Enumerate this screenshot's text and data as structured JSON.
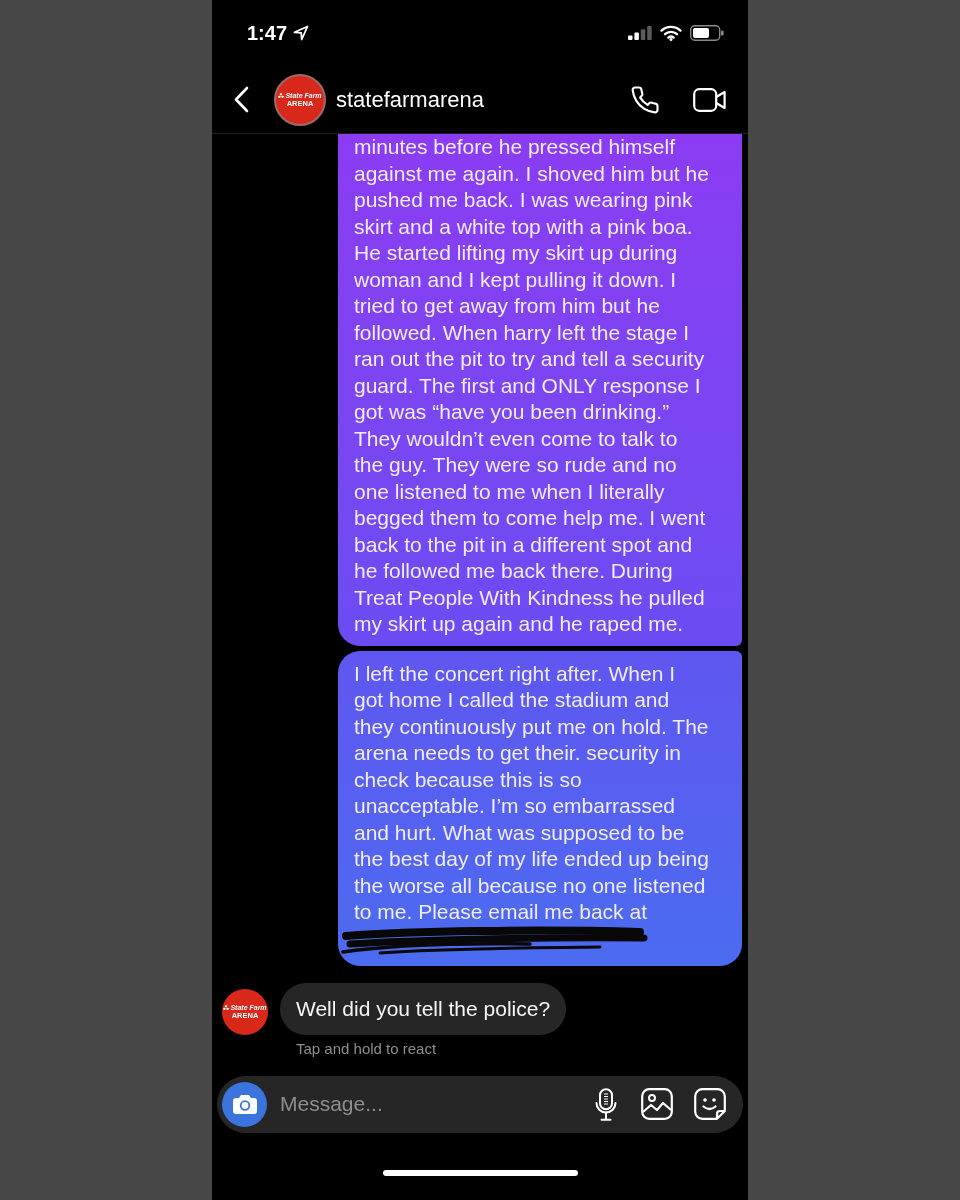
{
  "status_bar": {
    "time": "1:47"
  },
  "header": {
    "name": "statefarmarena",
    "avatar_logo": [
      "State Farm",
      "ARENA"
    ]
  },
  "messages": [
    {
      "kind": "outgoing",
      "text": "minutes before he pressed himself\nagainst me again. I shoved him but he\npushed me back. I was wearing pink\nskirt and a white top with a pink boa.\nHe started lifting my skirt up during\nwoman and I kept pulling it down. I\ntried to get away from him but he\nfollowed. When harry left the stage I\nran out the pit to try and tell a security\nguard. The first and ONLY response I\ngot was “have you been drinking.”\nThey wouldn’t even come to talk to\nthe guy. They were so rude and no\none listened to me when I literally\nbegged them to come help me. I went\nback to the pit in a different spot and\nhe followed me back there. During\nTreat People With Kindness he pulled\nmy skirt up again and he raped me.",
      "redacted": false
    },
    {
      "kind": "outgoing",
      "text": "I left the concert right after. When I\ngot home I called the stadium and\nthey continuously put me on hold. The\narena needs to get their. security in\ncheck because this is so\nunacceptable. I’m so embarrassed\nand hurt. What was supposed to be\nthe best day of my life ended up being\nthe worse all because no one listened\nto me. Please email me back at",
      "redacted": true
    },
    {
      "kind": "incoming",
      "avatar_logo": [
        "State Farm",
        "ARENA"
      ],
      "text": "Well did you tell the police?",
      "redacted": false
    }
  ],
  "reaction_hint": "Tap and hold to react",
  "composer": {
    "placeholder": "Message..."
  }
}
